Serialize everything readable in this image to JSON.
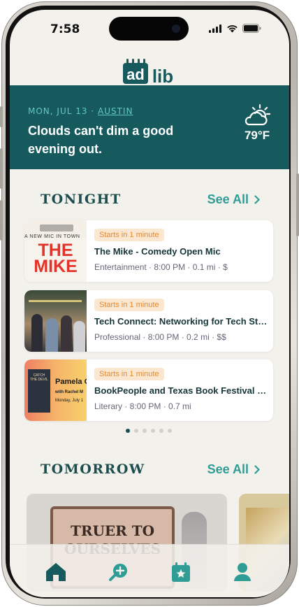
{
  "status_bar": {
    "time": "7:58"
  },
  "app": {
    "logo_text_ad": "ad",
    "logo_text_lib": "lib"
  },
  "weather": {
    "date": "MON, JUL 13",
    "separator": "·",
    "city": "AUSTIN",
    "message": "Clouds can't dim a good evening out.",
    "temperature": "79°F",
    "icon": "partly-cloudy-icon"
  },
  "tonight": {
    "title": "TONIGHT",
    "see_all": "See All",
    "events": [
      {
        "badge": "Starts in 1 minute",
        "title": "The Mike - Comedy Open Mic",
        "meta": "Entertainment · 8:00 PM · 0.1 mi · $",
        "thumb_text_top": "A NEW MIC IN TOWN",
        "thumb_text_main": "THE MIKE"
      },
      {
        "badge": "Starts in 1 minute",
        "title": "Tech Connect: Networking for Tech Startups",
        "meta": "Professional · 8:00 PM · 0.2 mi · $$"
      },
      {
        "badge": "Starts in 1 minute",
        "title": "BookPeople and Texas Book Festival Present",
        "meta": "Literary · 8:00 PM · 0.7 mi",
        "thumb_text_book": "CATCH THE DEVIL",
        "thumb_text_name": "Pamela C",
        "thumb_text_with": "with Rachel M",
        "thumb_text_date": "Monday, July 1"
      }
    ],
    "pagination": {
      "total": 6,
      "active": 0
    }
  },
  "tomorrow": {
    "title": "TOMORROW",
    "see_all": "See All",
    "card1_sign_line1": "TRUER TO",
    "card1_sign_line2": "OURSELVES"
  },
  "tab_bar": {
    "items": [
      {
        "name": "home",
        "icon": "home-icon",
        "active": true
      },
      {
        "name": "search",
        "icon": "search-plus-icon"
      },
      {
        "name": "calendar",
        "icon": "calendar-star-icon"
      },
      {
        "name": "profile",
        "icon": "user-icon"
      }
    ]
  },
  "colors": {
    "brand": "#175a5d",
    "accent": "#2f9d95",
    "badge_bg": "#fbe6cf",
    "badge_text": "#e58b2e"
  }
}
